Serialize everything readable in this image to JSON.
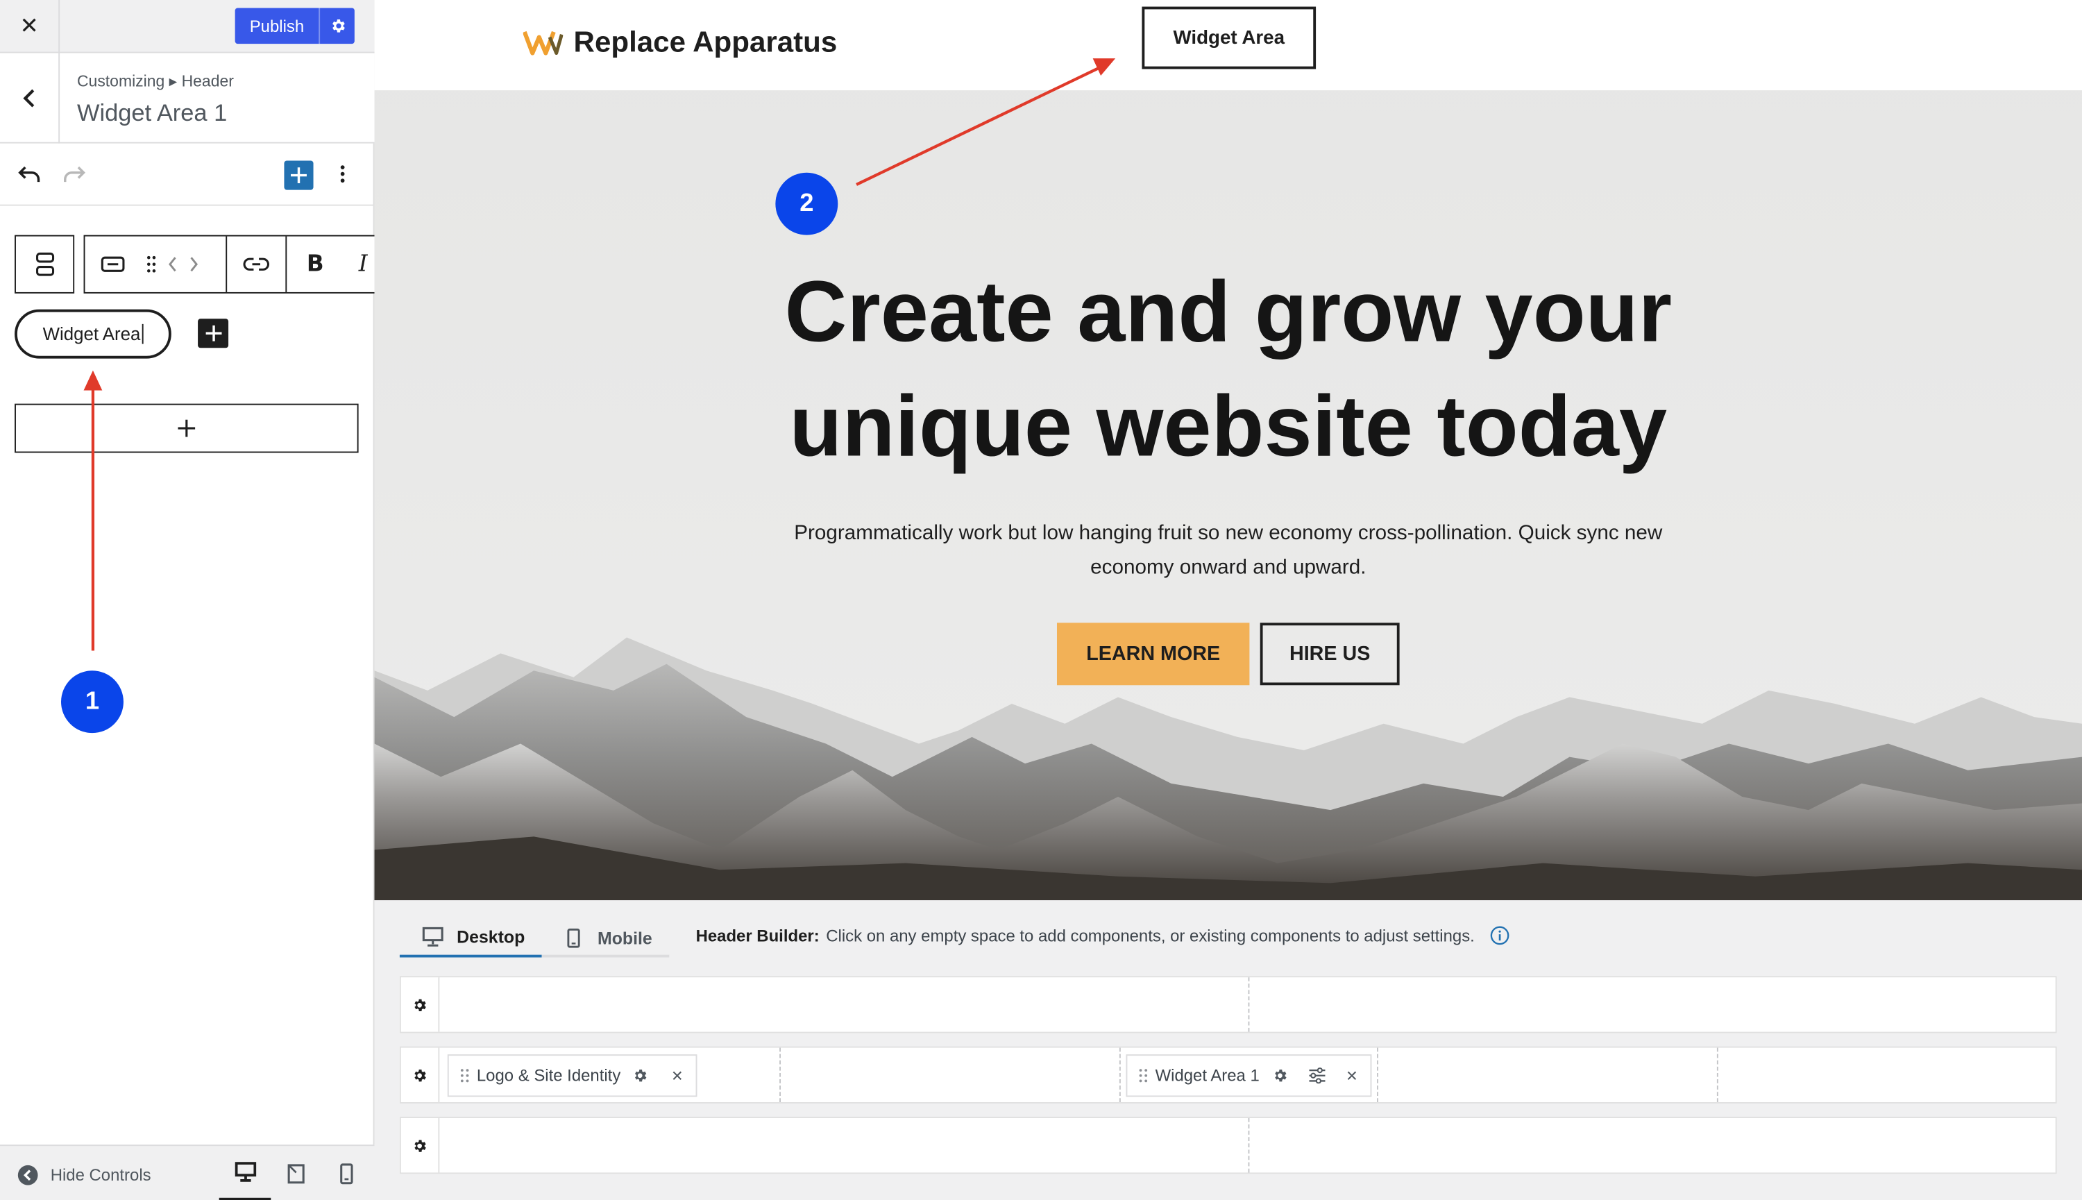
{
  "sidebar": {
    "publish_label": "Publish",
    "breadcrumb": "Customizing ▸ Header",
    "section_title": "Widget Area 1",
    "widget_area_text": "Widget Area",
    "hide_controls_label": "Hide Controls"
  },
  "preview": {
    "site_title": "Replace Apparatus",
    "header_widget_text": "Widget Area",
    "hero_title_line1": "Create and grow your",
    "hero_title_line2": "unique website today",
    "hero_text_line1": "Programmatically work but low hanging fruit so new economy cross-pollination. Quick sync new",
    "hero_text_line2": "economy onward and upward.",
    "learn_more_label": "LEARN MORE",
    "hire_us_label": "HIRE US"
  },
  "builder": {
    "desktop_tab": "Desktop",
    "mobile_tab": "Mobile",
    "desc_label": "Header Builder:",
    "desc_text": "Click on any empty space to add components, or existing components to adjust settings.",
    "logo_chip": "Logo & Site Identity",
    "widget_chip": "Widget Area 1"
  },
  "annotations": {
    "badge1": "1",
    "badge2": "2"
  },
  "colors": {
    "publish": "#3858e9",
    "annotation_badge": "#0a45ea",
    "annotation_arrow": "#e03a2a",
    "learn_more": "#f2b157",
    "active_tab": "#2271b1",
    "add_block_button": "#2271b1"
  }
}
